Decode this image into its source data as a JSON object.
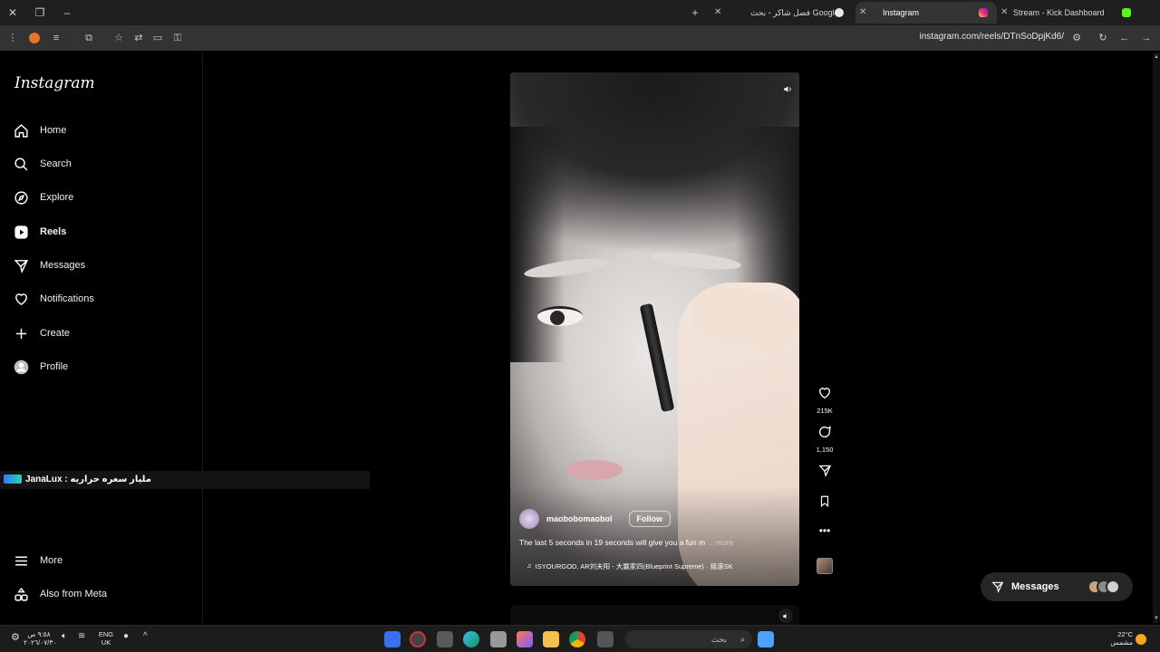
{
  "browser": {
    "tabs": [
      {
        "title": "Stream - Kick Dashboard",
        "active": false
      },
      {
        "title": "Instagram",
        "active": true
      },
      {
        "title": "فضل شاكر - بحث Google",
        "active": false
      }
    ],
    "url": "instagram.com/reels/DTnSoDpjKd6/"
  },
  "sidebar": {
    "logo": "Instagram",
    "items": [
      {
        "label": "Home",
        "icon": "home-icon"
      },
      {
        "label": "Search",
        "icon": "search-icon"
      },
      {
        "label": "Explore",
        "icon": "compass-icon"
      },
      {
        "label": "Reels",
        "icon": "reels-icon"
      },
      {
        "label": "Messages",
        "icon": "send-icon"
      },
      {
        "label": "Notifications",
        "icon": "heart-icon"
      },
      {
        "label": "Create",
        "icon": "plus-icon"
      },
      {
        "label": "Profile",
        "icon": "avatar-icon"
      }
    ],
    "bottom": [
      {
        "label": "More",
        "icon": "menu-icon"
      },
      {
        "label": "Also from Meta",
        "icon": "meta-icon"
      }
    ]
  },
  "overlay": {
    "text": "JanaLux : مليار سعره حراريه"
  },
  "reel": {
    "author": "maobobomaobol",
    "follow_label": "Follow",
    "caption": "The last 5 seconds in 19 seconds will give you a fun m",
    "caption_more": "... more",
    "music": "ISYOURGOD, AR刘夫阳 - 大赢家四(Blueprint Supreme) · 摇滚SK",
    "likes": "215K",
    "comments": "1,150"
  },
  "messages_pill": {
    "label": "Messages"
  },
  "taskbar": {
    "time": "٩:٥٨ ص",
    "date": "٢٠٢٦/٠٧/٣٠",
    "lang": "ENG",
    "region": "UK",
    "search_placeholder": "بحث",
    "temperature": "22°C",
    "weather": "مشمس"
  },
  "colors": {
    "background": "#000000",
    "panel": "#262626",
    "accent_kick": "#53fc18",
    "accent_instagram": "#e1306c"
  }
}
